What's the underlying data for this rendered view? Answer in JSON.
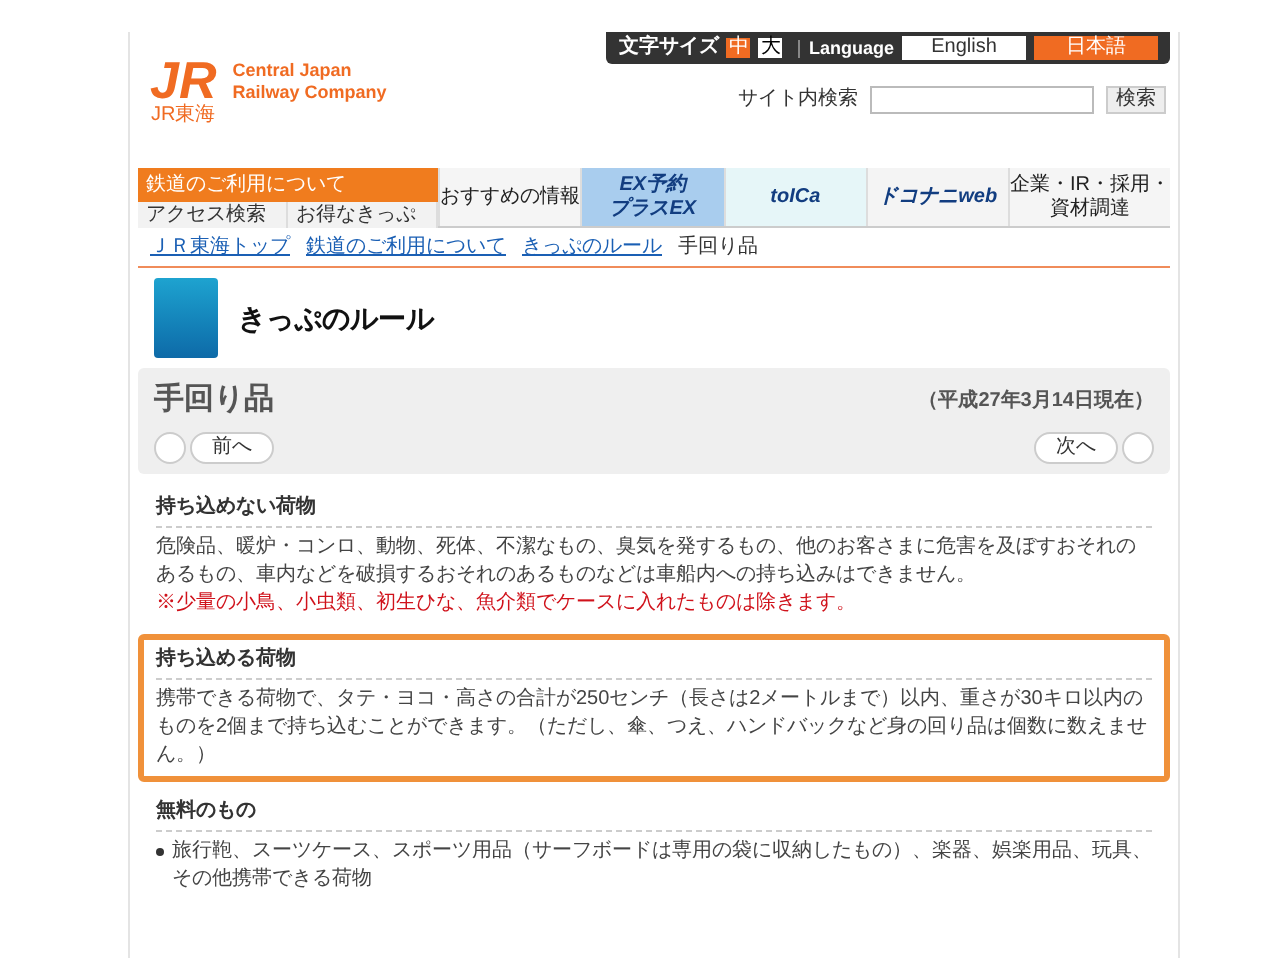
{
  "header": {
    "logo_mark": "JR",
    "logo_sub": "JR東海",
    "company": [
      "Central Japan",
      "Railway Company"
    ],
    "font_size_label": "文字サイズ",
    "font_sizes": [
      {
        "label": "中",
        "selected": true
      },
      {
        "label": "大",
        "selected": false
      }
    ],
    "language_label": "Language",
    "languages": [
      {
        "label": "English",
        "selected": false
      },
      {
        "label": "日本語",
        "selected": true
      }
    ],
    "search_label": "サイト内検索",
    "search_button": "検索"
  },
  "nav": {
    "main_tab": "鉄道のご利用について",
    "sub_tabs": [
      "アクセス検索",
      "お得なきっぷ"
    ],
    "items": [
      {
        "kind": "link",
        "lines": [
          "おすすめの情報"
        ]
      },
      {
        "kind": "banner",
        "color": "#a9cdee",
        "lines": [
          "EX予約",
          "プラスEX"
        ]
      },
      {
        "kind": "banner",
        "color": "#e6f6f8",
        "lines": [
          "toICa"
        ]
      },
      {
        "kind": "banner",
        "color": "#f4f4f4",
        "lines": [
          "ドコナニweb"
        ]
      },
      {
        "kind": "link",
        "lines": [
          "企業・IR・採用・",
          "資材調達"
        ]
      }
    ]
  },
  "breadcrumb": [
    {
      "label": "ＪＲ東海トップ",
      "current": false
    },
    {
      "label": "鉄道のご利用について",
      "current": false
    },
    {
      "label": "きっぷのルール",
      "current": false
    },
    {
      "label": "手回り品",
      "current": true
    }
  ],
  "page_title": "きっぷのルール",
  "panel": {
    "title": "手回り品",
    "date": "（平成27年3月14日現在）",
    "prev": "前へ",
    "next": "次へ"
  },
  "sections": [
    {
      "heading": "持ち込めない荷物",
      "highlighted": false,
      "paragraphs": [
        {
          "kind": "body",
          "text": "危険品、暖炉・コンロ、動物、死体、不潔なもの、臭気を発するもの、他のお客さまに危害を及ぼすおそれのあるもの、車内などを破損するおそれのあるものなどは車船内への持ち込みはできません。"
        },
        {
          "kind": "note",
          "text": "※少量の小鳥、小虫類、初生ひな、魚介類でケースに入れたものは除きます。"
        }
      ]
    },
    {
      "heading": "持ち込める荷物",
      "highlighted": true,
      "paragraphs": [
        {
          "kind": "body",
          "text": "携帯できる荷物で、タテ・ヨコ・高さの合計が250センチ（長さは2メートルまで）以内、重さが30キロ以内のものを2個まで持ち込むことができます。（ただし、傘、つえ、ハンドバックなど身の回り品は個数に数えません。）"
        }
      ]
    },
    {
      "heading": "無料のもの",
      "highlighted": false,
      "paragraphs": [
        {
          "kind": "bullet",
          "text": "旅行鞄、スーツケース、スポーツ用品（サーフボードは専用の袋に収納したもの）、楽器、娯楽用品、玩具、その他携帯できる荷物"
        }
      ]
    }
  ]
}
